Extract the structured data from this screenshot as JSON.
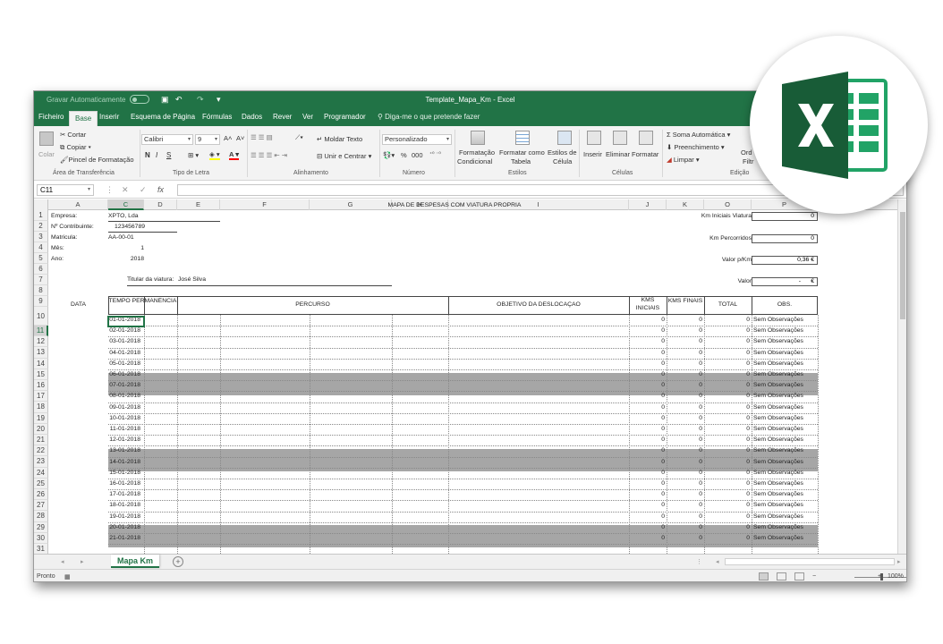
{
  "titlebar": {
    "autosave_label": "Gravar Automaticamente",
    "autosave_state": "off",
    "title": "Template_Mapa_Km  -  Excel"
  },
  "ribbon_tabs": [
    "Ficheiro",
    "Base",
    "Inserir",
    "Esquema de Página",
    "Fórmulas",
    "Dados",
    "Rever",
    "Ver",
    "Programador"
  ],
  "active_tab": "Base",
  "tell_me": "Diga-me o que pretende fazer",
  "ribbon": {
    "clipboard": {
      "paste": "Colar",
      "cut": "Cortar",
      "copy": "Copiar",
      "format_painter": "Pincel de Formatação",
      "label": "Área de Transferência"
    },
    "font": {
      "family": "Calibri",
      "size": "9",
      "label": "Tipo de Letra",
      "bold": "N",
      "italic": "I",
      "underline": "S",
      "grow": "A˄",
      "shrink": "A˅"
    },
    "alignment": {
      "wrap": "Moldar Texto",
      "merge": "Unir e Centrar",
      "label": "Alinhamento"
    },
    "number": {
      "format": "Personalizado",
      "label": "Número",
      "percent": "%",
      "thousands": "000"
    },
    "styles": {
      "conditional_1": "Formatação",
      "conditional_2": "Condicional",
      "table_1": "Formatar como",
      "table_2": "Tabela",
      "cell_1": "Estilos de",
      "cell_2": "Célula",
      "label": "Estilos"
    },
    "cells": {
      "insert": "Inserir",
      "delete": "Eliminar",
      "format": "Formatar",
      "label": "Células"
    },
    "editing": {
      "autosum": "Soma Automática",
      "fill": "Preenchimento",
      "clear": "Limpar",
      "sort_1": "Ord",
      "sort_2": "Filtr",
      "label": "Edição"
    }
  },
  "formula_bar": {
    "name_box": "C11",
    "cancel": "✕",
    "enter": "✓",
    "fx": "fx",
    "content": ""
  },
  "columns": [
    "A",
    "C",
    "D",
    "E",
    "F",
    "G",
    "H",
    "I",
    "J",
    "K",
    "O",
    "P"
  ],
  "selected_column": "C",
  "row_numbers": [
    "1",
    "2",
    "3",
    "4",
    "5",
    "6",
    "7",
    "8",
    "9",
    "10",
    "11",
    "12",
    "13",
    "14",
    "15",
    "16",
    "17",
    "18",
    "19",
    "20",
    "21",
    "22",
    "23",
    "24",
    "25",
    "26",
    "27",
    "28",
    "29",
    "30",
    "31"
  ],
  "selected_row": "11",
  "sheet": {
    "title": "MAPA DE DESPESAS COM VIATURA PRÓPRIA",
    "company_label": "Empresa:",
    "company": "XPTO, Lda",
    "nif_label": "Nº Contribuinte:",
    "nif": "123456789",
    "plate_label": "Matricula:",
    "plate": "AA-00-01",
    "month_label": "Mês:",
    "month": "1",
    "year_label": "Ano:",
    "year": "2018",
    "holder_label": "Titular da viatura:",
    "holder": "José Silva",
    "km_start_label": "Km Iniciais Viatura",
    "km_start": "0",
    "km_total_label": "Km Percorridos",
    "km_total": "0",
    "value_km_label": "Valor p/Km",
    "value_km": "0,36 €",
    "value_label": "Valor",
    "value_dash": "-",
    "value_currency": "€"
  },
  "table_headers": {
    "date": "DATA",
    "time": "TEMPO PERMANÊNCIA",
    "route": "PERCURSO",
    "purpose": "OBJETIVO DA DESLOCAÇÃO",
    "km_start_1": "KMS",
    "km_start_2": "INICIAIS",
    "km_end": "KMS FINAIS",
    "total": "TOTAL",
    "obs": "OBS."
  },
  "rows": [
    {
      "date": "01-01-2018",
      "km_start": "0",
      "km_end": "0",
      "total": "0",
      "obs": "Sem Observações",
      "weekend": false
    },
    {
      "date": "02-01-2018",
      "km_start": "0",
      "km_end": "0",
      "total": "0",
      "obs": "Sem Observações",
      "weekend": false
    },
    {
      "date": "03-01-2018",
      "km_start": "0",
      "km_end": "0",
      "total": "0",
      "obs": "Sem Observações",
      "weekend": false
    },
    {
      "date": "04-01-2018",
      "km_start": "0",
      "km_end": "0",
      "total": "0",
      "obs": "Sem Observações",
      "weekend": false
    },
    {
      "date": "05-01-2018",
      "km_start": "0",
      "km_end": "0",
      "total": "0",
      "obs": "Sem Observações",
      "weekend": false
    },
    {
      "date": "06-01-2018",
      "km_start": "0",
      "km_end": "0",
      "total": "0",
      "obs": "Sem Observações",
      "weekend": true
    },
    {
      "date": "07-01-2018",
      "km_start": "0",
      "km_end": "0",
      "total": "0",
      "obs": "Sem Observações",
      "weekend": true
    },
    {
      "date": "08-01-2018",
      "km_start": "0",
      "km_end": "0",
      "total": "0",
      "obs": "Sem Observações",
      "weekend": false
    },
    {
      "date": "09-01-2018",
      "km_start": "0",
      "km_end": "0",
      "total": "0",
      "obs": "Sem Observações",
      "weekend": false
    },
    {
      "date": "10-01-2018",
      "km_start": "0",
      "km_end": "0",
      "total": "0",
      "obs": "Sem Observações",
      "weekend": false
    },
    {
      "date": "11-01-2018",
      "km_start": "0",
      "km_end": "0",
      "total": "0",
      "obs": "Sem Observações",
      "weekend": false
    },
    {
      "date": "12-01-2018",
      "km_start": "0",
      "km_end": "0",
      "total": "0",
      "obs": "Sem Observações",
      "weekend": false
    },
    {
      "date": "13-01-2018",
      "km_start": "0",
      "km_end": "0",
      "total": "0",
      "obs": "Sem Observações",
      "weekend": true
    },
    {
      "date": "14-01-2018",
      "km_start": "0",
      "km_end": "0",
      "total": "0",
      "obs": "Sem Observações",
      "weekend": true
    },
    {
      "date": "15-01-2018",
      "km_start": "0",
      "km_end": "0",
      "total": "0",
      "obs": "Sem Observações",
      "weekend": false
    },
    {
      "date": "16-01-2018",
      "km_start": "0",
      "km_end": "0",
      "total": "0",
      "obs": "Sem Observações",
      "weekend": false
    },
    {
      "date": "17-01-2018",
      "km_start": "0",
      "km_end": "0",
      "total": "0",
      "obs": "Sem Observações",
      "weekend": false
    },
    {
      "date": "18-01-2018",
      "km_start": "0",
      "km_end": "0",
      "total": "0",
      "obs": "Sem Observações",
      "weekend": false
    },
    {
      "date": "19-01-2018",
      "km_start": "0",
      "km_end": "0",
      "total": "0",
      "obs": "Sem Observações",
      "weekend": false
    },
    {
      "date": "20-01-2018",
      "km_start": "0",
      "km_end": "0",
      "total": "0",
      "obs": "Sem Observações",
      "weekend": true
    },
    {
      "date": "21-01-2018",
      "km_start": "0",
      "km_end": "0",
      "total": "0",
      "obs": "Sem Observações",
      "weekend": true
    }
  ],
  "sheet_tab": "Mapa Km",
  "add_sheet": "+",
  "status": {
    "ready": "Pronto",
    "zoom": "100%",
    "zoom_minus": "−",
    "zoom_plus": "+"
  },
  "colors": {
    "excel_green": "#217346",
    "weekend_shade": "#a6a6a6",
    "logo_dark": "#185c37"
  }
}
